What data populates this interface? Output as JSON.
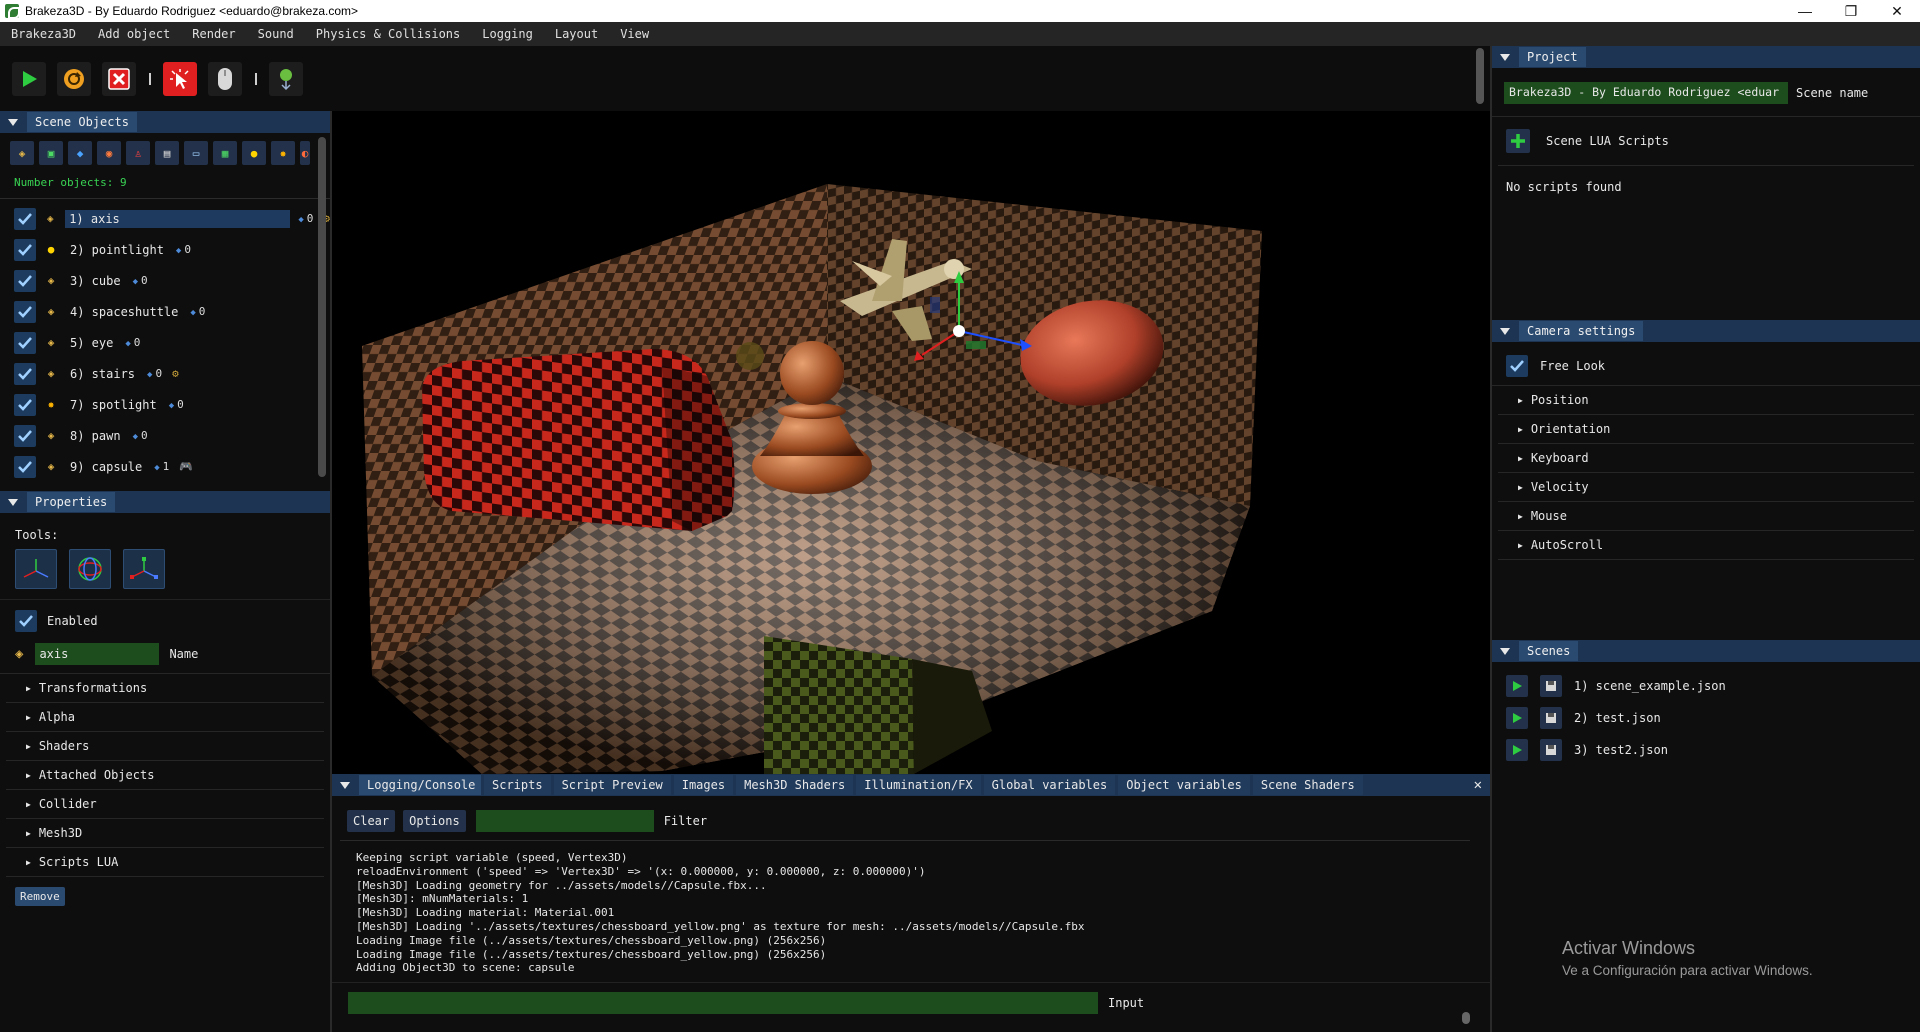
{
  "window": {
    "title": "Brakeza3D - By Eduardo Rodriguez <eduardo@brakeza.com>",
    "controls": [
      "—",
      "❐",
      "✕"
    ]
  },
  "menu": [
    "Brakeza3D",
    "Add object",
    "Render",
    "Sound",
    "Physics & Collisions",
    "Logging",
    "Layout",
    "View"
  ],
  "toolbar": {
    "buttons": [
      "play-icon",
      "reload-icon",
      "stop-icon",
      "pointer-icon",
      "mouse-icon",
      "light-icon"
    ],
    "colors": {
      "play": "#2ecc40",
      "reload": "#f0a020",
      "stop": "#e02020",
      "pointer": "#e02020"
    }
  },
  "scene_objects": {
    "title": "Scene Objects",
    "count_text": "Number objects: 9",
    "items": [
      {
        "label": "1) axis",
        "badge": "0",
        "extra": "⚙",
        "icon": "object-icon",
        "selected": true
      },
      {
        "label": "2) pointlight",
        "badge": "0",
        "extra": "",
        "icon": "bulb-icon",
        "selected": false
      },
      {
        "label": "3) cube",
        "badge": "0",
        "extra": "",
        "icon": "object-icon",
        "selected": false
      },
      {
        "label": "4) spaceshuttle",
        "badge": "0",
        "extra": "",
        "icon": "object-icon",
        "selected": false
      },
      {
        "label": "5) eye",
        "badge": "0",
        "extra": "",
        "icon": "object-icon",
        "selected": false
      },
      {
        "label": "6) stairs",
        "badge": "0",
        "extra": "⚙",
        "icon": "object-icon",
        "selected": false
      },
      {
        "label": "7) spotlight",
        "badge": "0",
        "extra": "",
        "icon": "spot-icon",
        "selected": false
      },
      {
        "label": "8) pawn",
        "badge": "0",
        "extra": "",
        "icon": "object-icon",
        "selected": false
      },
      {
        "label": "9) capsule",
        "badge": "1",
        "extra": "🎮",
        "icon": "object-icon",
        "selected": false
      }
    ]
  },
  "properties": {
    "title": "Properties",
    "tools_label": "Tools:",
    "enabled_label": "Enabled",
    "name_value": "axis",
    "name_label": "Name",
    "sections": [
      "Transformations",
      "Alpha",
      "Shaders",
      "Attached Objects",
      "Collider",
      "Mesh3D",
      "Scripts LUA"
    ],
    "remove_label": "Remove"
  },
  "logging": {
    "tabs": [
      "Logging/Console",
      "Scripts",
      "Script Preview",
      "Images",
      "Mesh3D Shaders",
      "Illumination/FX",
      "Global variables",
      "Object variables",
      "Scene Shaders"
    ],
    "close": "✕",
    "clear_label": "Clear",
    "options_label": "Options",
    "filter_label": "Filter",
    "input_label": "Input",
    "lines": [
      "Keeping script variable (speed, Vertex3D)",
      "reloadEnvironment ('speed' => 'Vertex3D' => '(x: 0.000000, y: 0.000000, z: 0.000000)')",
      "[Mesh3D] Loading geometry for ../assets/models//Capsule.fbx...",
      "[Mesh3D]: mNumMaterials: 1",
      "[Mesh3D] Loading material: Material.001",
      "[Mesh3D] Loading '../assets/textures/chessboard_yellow.png' as texture for mesh: ../assets/models//Capsule.fbx",
      "Loading Image file (../assets/textures/chessboard_yellow.png) (256x256)",
      "Loading Image file (../assets/textures/chessboard_yellow.png) (256x256)",
      "Adding Object3D to scene: capsule"
    ]
  },
  "project": {
    "title": "Project",
    "scene_title_value": "Brakeza3D - By Eduardo Rodriguez <eduar",
    "scene_name_label": "Scene name",
    "scripts_label": "Scene LUA Scripts",
    "no_scripts": "No scripts found"
  },
  "camera": {
    "title": "Camera settings",
    "freelook_label": "Free Look",
    "sections": [
      "Position",
      "Orientation",
      "Keyboard",
      "Velocity",
      "Mouse",
      "AutoScroll"
    ]
  },
  "scenes": {
    "title": "Scenes",
    "items": [
      "1) scene_example.json",
      "2) test.json",
      "3) test2.json"
    ]
  },
  "watermark": {
    "line1": "Activar Windows",
    "line2": "Ve a Configuración para activar Windows."
  }
}
